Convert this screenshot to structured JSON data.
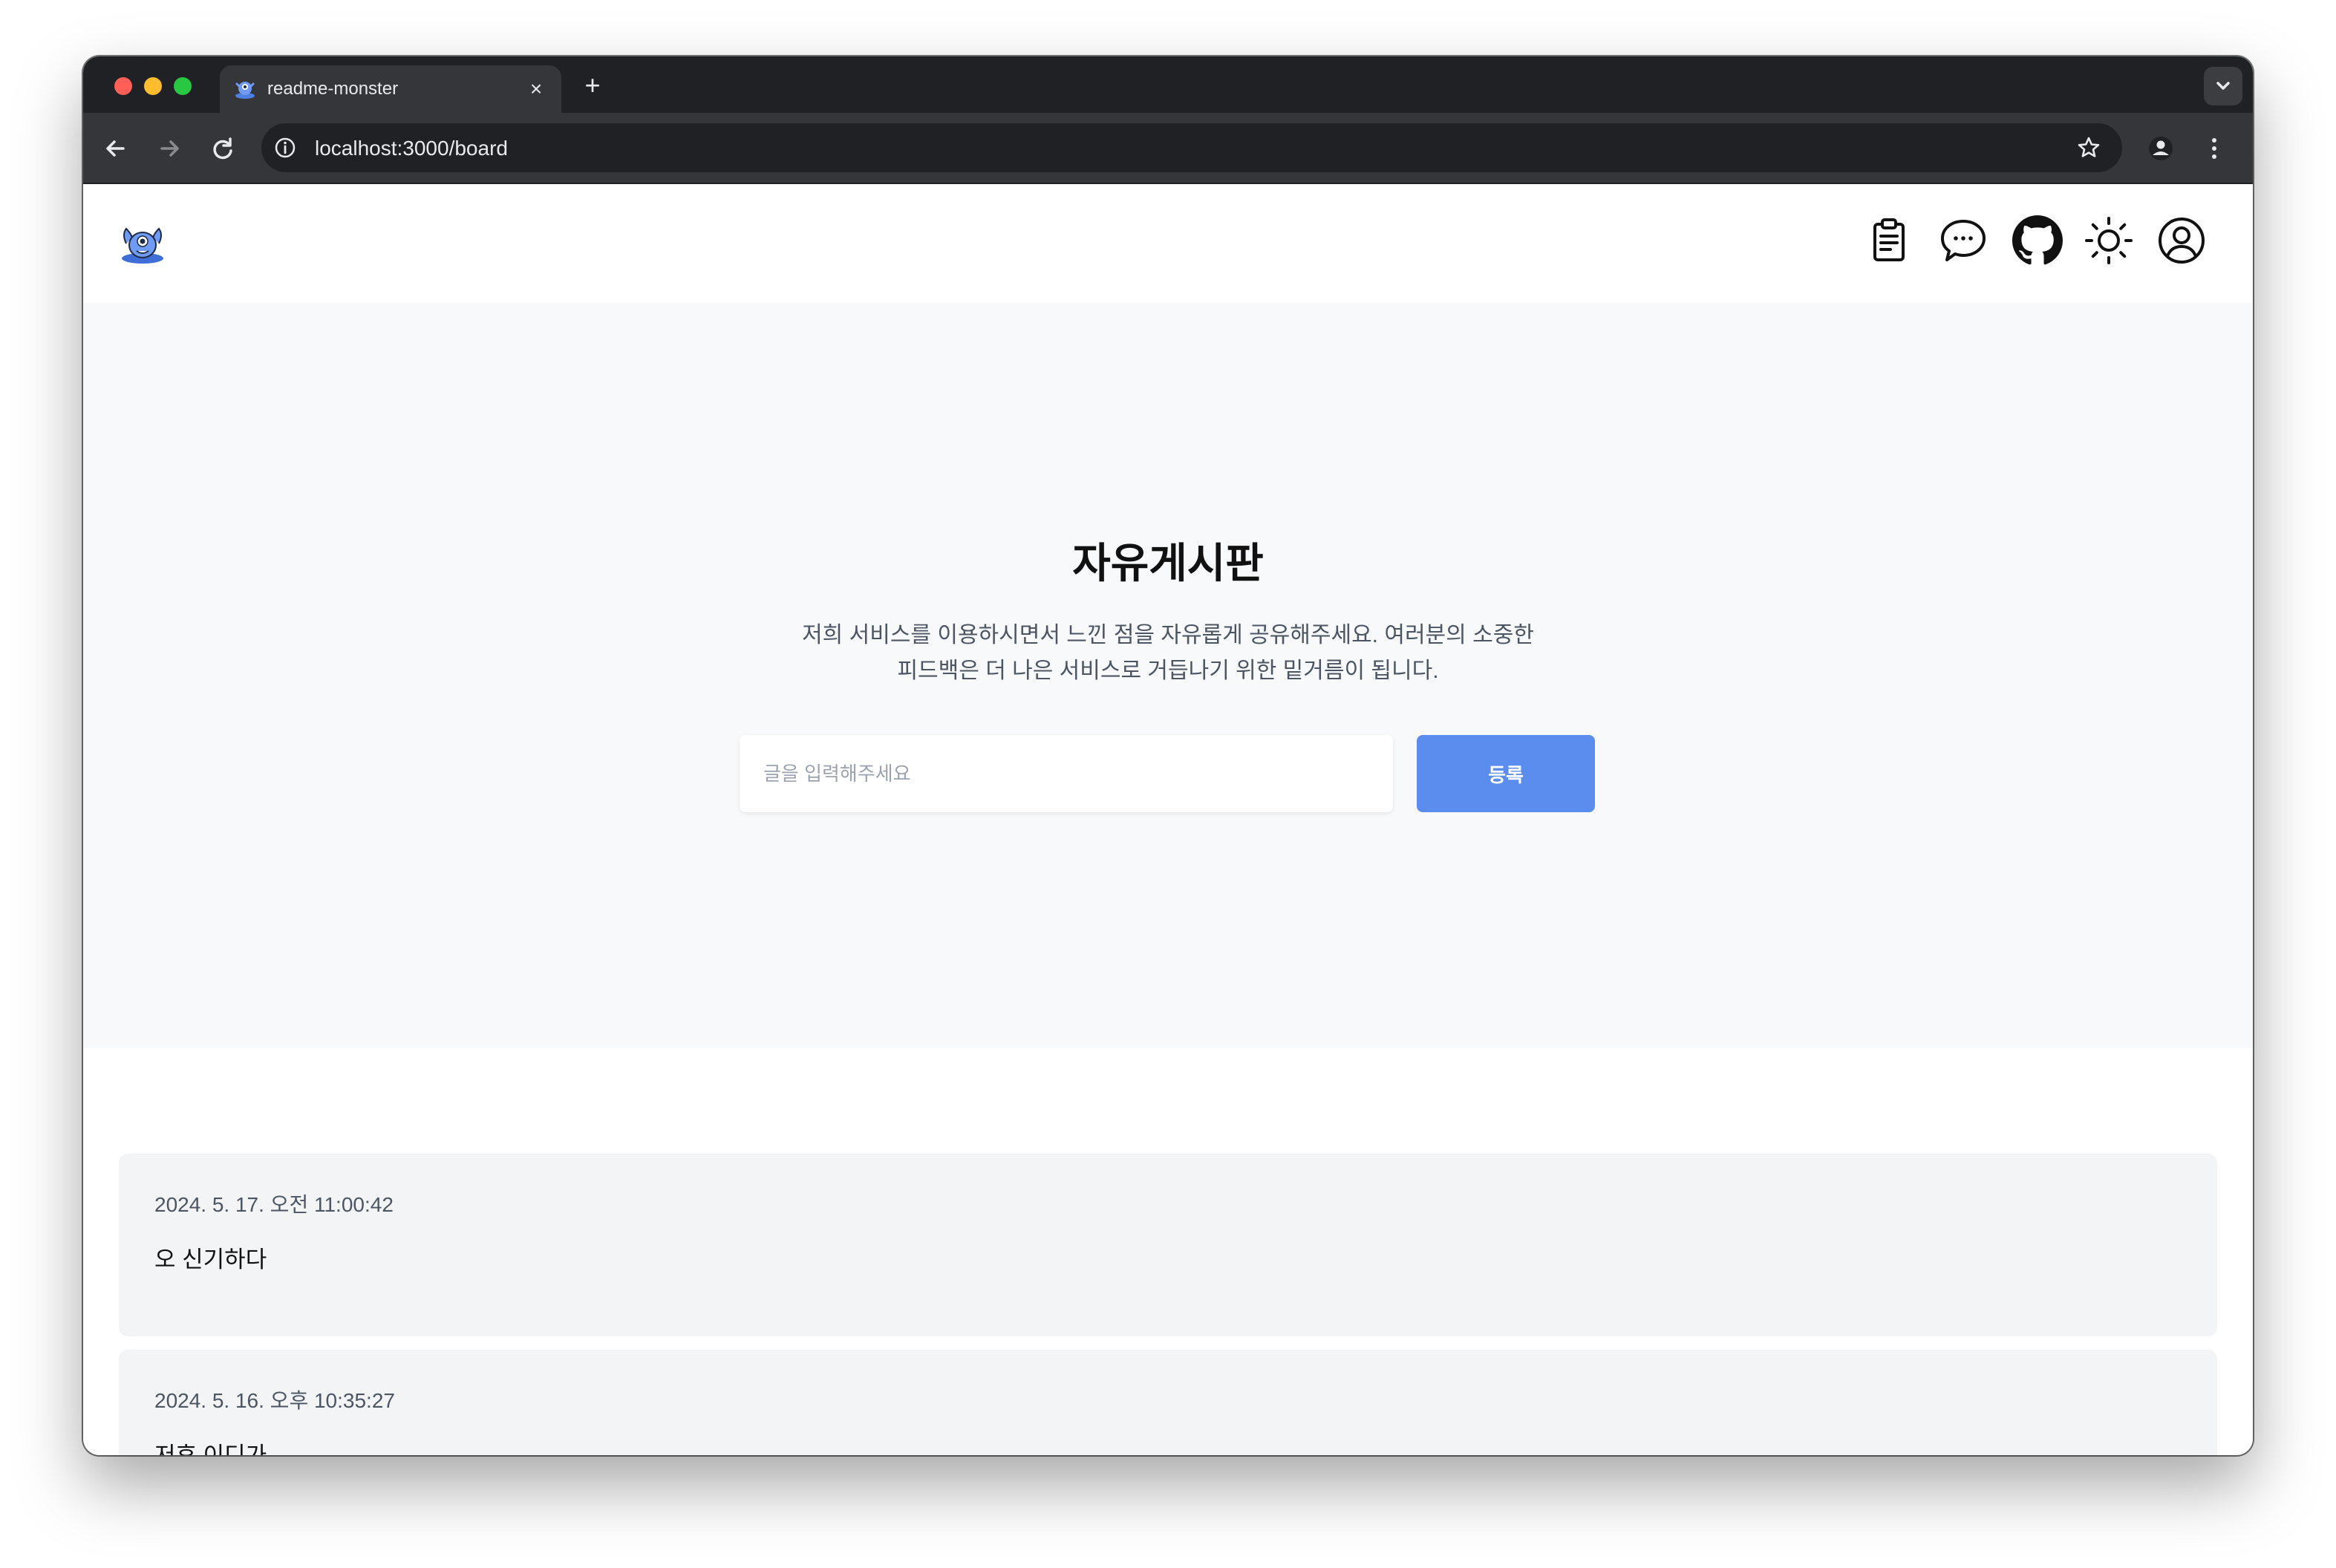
{
  "browser": {
    "tab_title": "readme-monster",
    "tab_close": "×",
    "new_tab": "+",
    "url": "localhost:3000/board",
    "icons": [
      "back-icon",
      "forward-icon",
      "reload-icon",
      "info-icon",
      "star-icon",
      "profile-icon",
      "more-icon",
      "chevron-down-icon"
    ]
  },
  "header": {
    "logo": "readme-monster-logo",
    "nav_icons": [
      "clipboard-icon",
      "chat-icon",
      "github-icon",
      "sun-icon",
      "user-icon"
    ]
  },
  "hero": {
    "title": "자유게시판",
    "description_line1": "저희 서비스를 이용하시면서 느낀 점을 자유롭게 공유해주세요. 여러분의 소중한",
    "description_line2": "피드백은 더 나은 서비스로 거듭나기 위한 밑거름이 됩니다.",
    "input_placeholder": "글을 입력해주세요",
    "submit_label": "등록"
  },
  "posts": [
    {
      "date": "2024. 5. 17. 오전 11:00:42",
      "text": "오 신기하다"
    },
    {
      "date": "2024. 5. 16. 오후 10:35:27",
      "text": "저후 이디가"
    }
  ],
  "colors": {
    "accent": "#5b8def",
    "hero_bg": "#f8f9fa",
    "card_bg": "#f3f4f6",
    "browser_dark": "#202124",
    "browser_tab": "#35363a"
  }
}
